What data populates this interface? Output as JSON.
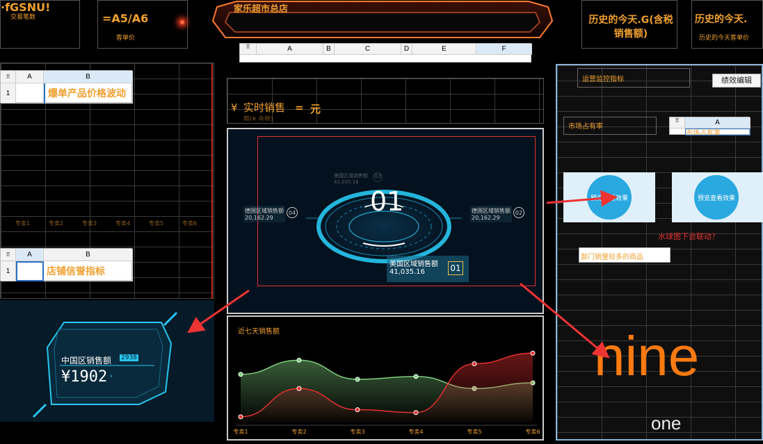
{
  "top_kpis": {
    "trade_label": "交易笔数",
    "trade_value": "·fGSNU!",
    "price_value": "=A5/A6",
    "price_label": "客单价",
    "store_title": "家乐超市总店",
    "history1_title": "历史的今天.G(含税销售额)",
    "history2_title": "历史的今天.",
    "history2_sub": "历史的今天客单价"
  },
  "column_strip": {
    "cols": [
      "A",
      "B",
      "C",
      "D",
      "E",
      "F"
    ]
  },
  "left_panel": {
    "sheet1": {
      "col_a": "A",
      "col_b": "B",
      "row": "1",
      "b1": "爆单产品价格波动"
    },
    "x_ticks": [
      "专卖1",
      "专卖2",
      "专卖3",
      "专卖4",
      "专卖5",
      "专卖6"
    ],
    "sheet2": {
      "col_a": "A",
      "col_b": "B",
      "row": "1",
      "b1": "店铺信誉指标"
    },
    "china_sales_label": "中国区销售额",
    "china_sales_badge": "2938",
    "china_sales_value": "¥1902"
  },
  "center_panel": {
    "realtime_prefix": "¥",
    "realtime_label": "实时销售",
    "realtime_sub": "额(¥ 含税)",
    "eq": "=",
    "unit": "元",
    "ring_number": "01",
    "labels": {
      "top": "美国区域销售额",
      "top_val": "41,035.16",
      "top_badge": "03",
      "left": "德国区域销售额",
      "left_val": "20,162.29",
      "left_badge": "04",
      "right": "德国区域销售额",
      "right_val": "20,162.29",
      "right_badge": "02",
      "main": "美国区域销售额",
      "main_val": "41,035.16",
      "main_badge": "01"
    }
  },
  "chart_data": {
    "type": "area",
    "title": "近七天销售额",
    "categories": [
      "专卖1",
      "专卖2",
      "专卖3",
      "专卖4",
      "专卖5",
      "专卖6"
    ],
    "series": [
      {
        "color": "#7fd07f",
        "values": [
          68,
          88,
          61,
          65,
          48,
          56
        ]
      },
      {
        "color": "#e83030",
        "values": [
          8,
          48,
          18,
          14,
          83,
          98
        ]
      }
    ],
    "ylim": [
      0,
      110
    ],
    "grid": false
  },
  "right_panel": {
    "title": "运营监控指标",
    "edit_button": "绩效编辑",
    "market_share": "市场占有率",
    "mini_col": "A",
    "mini_cell": "市场占有率",
    "preview_left": "预览查看效果",
    "preview_right": "预览查看效果",
    "question": "水球图下会联动？",
    "dept_products": "部门销量较多的商品",
    "big_text": "nine",
    "small_text": "one"
  },
  "colors": {
    "accent_orange": "#f0a030",
    "cyan": "#28c8f0",
    "red": "#e33030",
    "green": "#7fd07f"
  }
}
